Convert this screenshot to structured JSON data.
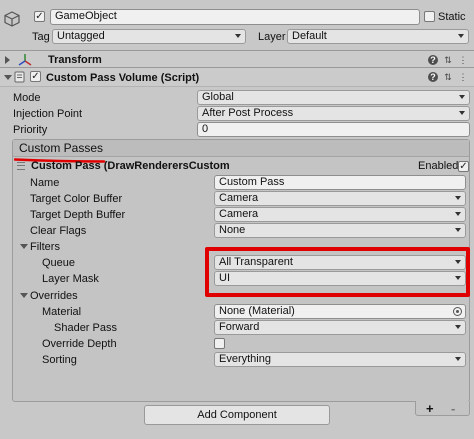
{
  "gameobject": {
    "name": "GameObject",
    "static_label": "Static",
    "tag_label": "Tag",
    "tag_value": "Untagged",
    "layer_label": "Layer",
    "layer_value": "Default"
  },
  "transform": {
    "title": "Transform"
  },
  "component": {
    "title": "Custom Pass Volume (Script)",
    "mode_label": "Mode",
    "mode_value": "Global",
    "injection_label": "Injection Point",
    "injection_value": "After Post Process",
    "priority_label": "Priority",
    "priority_value": "0"
  },
  "custom_passes": {
    "title": "Custom Passes",
    "pass_title": "Custom Pass (DrawRenderersCustom",
    "enabled_label": "Enabled",
    "name_label": "Name",
    "name_value": "Custom Pass",
    "color_buffer_label": "Target Color Buffer",
    "color_buffer_value": "Camera",
    "depth_buffer_label": "Target Depth Buffer",
    "depth_buffer_value": "Camera",
    "clear_flags_label": "Clear Flags",
    "clear_flags_value": "None",
    "filters_label": "Filters",
    "queue_label": "Queue",
    "queue_value": "All Transparent",
    "layer_mask_label": "Layer Mask",
    "layer_mask_value": "UI",
    "overrides_label": "Overrides",
    "material_label": "Material",
    "material_value": "None (Material)",
    "shader_pass_label": "Shader Pass",
    "shader_pass_value": "Forward",
    "override_depth_label": "Override Depth",
    "sorting_label": "Sorting",
    "sorting_value": "Everything",
    "add_symbol": "+",
    "remove_symbol": "-"
  },
  "footer": {
    "add_component": "Add Component"
  },
  "colors": {
    "highlight": "#e00000",
    "background": "#c8c8c8"
  }
}
